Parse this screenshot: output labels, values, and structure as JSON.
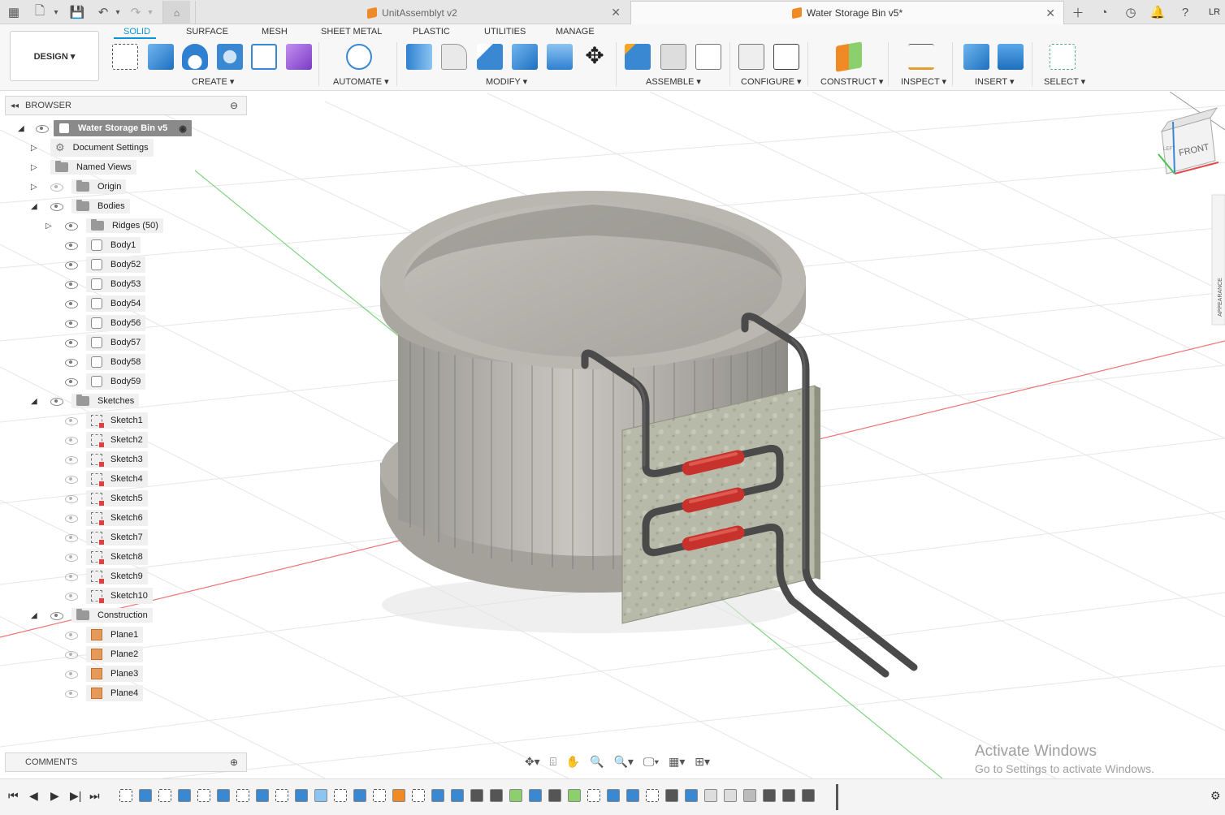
{
  "tabs": [
    {
      "title": "UnitAssemblyt v2",
      "active": false
    },
    {
      "title": "Water Storage Bin v5*",
      "active": true
    }
  ],
  "user_initials": "LR",
  "ribbon": {
    "workspace_button": "DESIGN ▾",
    "tabs": [
      "SOLID",
      "SURFACE",
      "MESH",
      "SHEET METAL",
      "PLASTIC",
      "UTILITIES",
      "MANAGE"
    ],
    "groups": [
      "CREATE ▾",
      "AUTOMATE ▾",
      "MODIFY ▾",
      "ASSEMBLE ▾",
      "CONFIGURE ▾",
      "CONSTRUCT ▾",
      "INSPECT ▾",
      "INSERT ▾",
      "SELECT ▾"
    ]
  },
  "browser": {
    "title": "BROWSER",
    "root": "Water Storage Bin v5",
    "document_settings": "Document Settings",
    "named_views": "Named Views",
    "origin": "Origin",
    "bodies": "Bodies",
    "ridges": "Ridges (50)",
    "body_items": [
      "Body1",
      "Body52",
      "Body53",
      "Body54",
      "Body56",
      "Body57",
      "Body58",
      "Body59"
    ],
    "sketches": "Sketches",
    "sketch_items": [
      "Sketch1",
      "Sketch2",
      "Sketch3",
      "Sketch4",
      "Sketch5",
      "Sketch6",
      "Sketch7",
      "Sketch8",
      "Sketch9",
      "Sketch10"
    ],
    "construction": "Construction",
    "plane_items": [
      "Plane1",
      "Plane2",
      "Plane3",
      "Plane4"
    ]
  },
  "comments": {
    "title": "COMMENTS"
  },
  "viewcube": {
    "face_front": "FRONT",
    "face_left": "LEFT"
  },
  "watermark": {
    "line1": "Activate Windows",
    "line2": "Go to Settings to activate Windows."
  },
  "side_panel": {
    "label": "APPEARANCE"
  },
  "colors": {
    "accent": "#0696d7",
    "axis_red": "#e8484a",
    "axis_green": "#4cc24c",
    "bin_gray": "#b3b1aa",
    "heater_red": "#c8322c",
    "board_gray": "#b5b8a8"
  }
}
